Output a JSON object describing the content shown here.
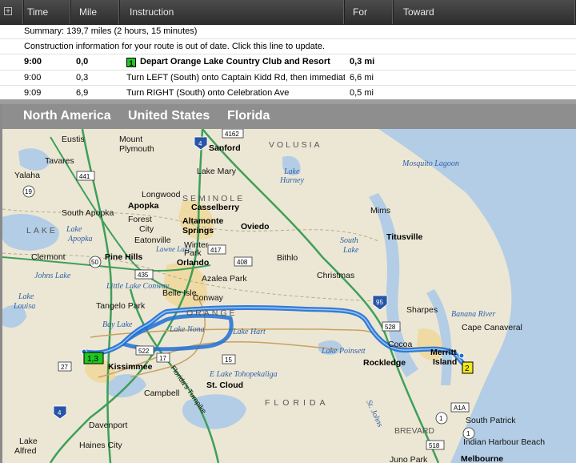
{
  "columns": [
    "Time",
    "Mile",
    "Instruction",
    "For",
    "Toward"
  ],
  "rows": {
    "summary": "Summary:  139,7 miles (2 hours, 15 minutes)",
    "construction": "Construction information for your route is out of date.  Click this line to update.",
    "steps": [
      {
        "time": "9:00",
        "mile": "0,0",
        "flag": "1",
        "instruction": "Depart Orange Lake Country Club and Resort",
        "for": "0,3 mi"
      },
      {
        "time": "9:00",
        "mile": "0,3",
        "instruction": "Turn LEFT (South) onto Captain Kidd Rd, then immediately",
        "for": "6,6 mi"
      },
      {
        "time": "9:09",
        "mile": "6,9",
        "instruction": "Turn RIGHT (South) onto Celebration Ave",
        "for": "0,5 mi"
      }
    ]
  },
  "breadcrumb": [
    "North America",
    "United States",
    "Florida"
  ],
  "map": {
    "colors": {
      "land": "#ece7d4",
      "water": "#b3cde6",
      "route": "#1f6fd6",
      "highway": "#3f9f5a",
      "urban": "#f0d79a"
    },
    "cities_bold": [
      "Sanford",
      "Apopka",
      "Casselberry",
      "Altamonte",
      "Springs",
      "Oviedo",
      "Pine Hills",
      "Orlando",
      "Titusville",
      "Kissimmee",
      "St. Cloud",
      "Rockledge",
      "Merritt",
      "Island",
      "Melbourne"
    ],
    "cities": [
      "Eustis",
      "Mount",
      "Plymouth",
      "Tavares",
      "Yalaha",
      "Lake Mary",
      "Longwood",
      "South Apopka",
      "Forest",
      "City",
      "Eatonville",
      "Clermont",
      "Winter",
      "Park",
      "Bithlo",
      "Christmas",
      "Mims",
      "Conway",
      "Azalea Park",
      "Belle Isle",
      "Tangelo Park",
      "Sharpes",
      "Cocoa",
      "Cape Canaveral",
      "Campbell",
      "Davenport",
      "Haines City",
      "Lake",
      "Alfred",
      "South Patrick",
      "Indian Harbour Beach",
      "BREVARD",
      "Juno Park"
    ],
    "water": [
      "Mosquito Lagoon",
      "Lake",
      "Harney",
      "South",
      "Lake",
      "Lake",
      "Apopka",
      "Johns Lake",
      "Lake",
      "Louisa",
      "Little Lake Conway",
      "Lake Nona",
      "Lake Hart",
      "Bay Lake",
      "Lake Poinsett",
      "E Lake Tohopekaliga",
      "Banana River",
      "St. Johns",
      "Lawne Lake"
    ],
    "regions": [
      "VOLUSIA",
      "SEMINOLE",
      "ORANGE",
      "FLORIDA",
      "LAKE"
    ],
    "shields": [
      "4162",
      "4",
      "441",
      "19",
      "50",
      "435",
      "417",
      "408",
      "95",
      "528",
      "522",
      "17",
      "15",
      "27",
      "4",
      "A1A",
      "1",
      "518",
      "1"
    ],
    "route_labels": [
      "1,3",
      "2"
    ],
    "route_label_colors": [
      "#1ec81e",
      "#f2e81a"
    ],
    "road_labels": [
      "Florida's Turnpike"
    ]
  }
}
